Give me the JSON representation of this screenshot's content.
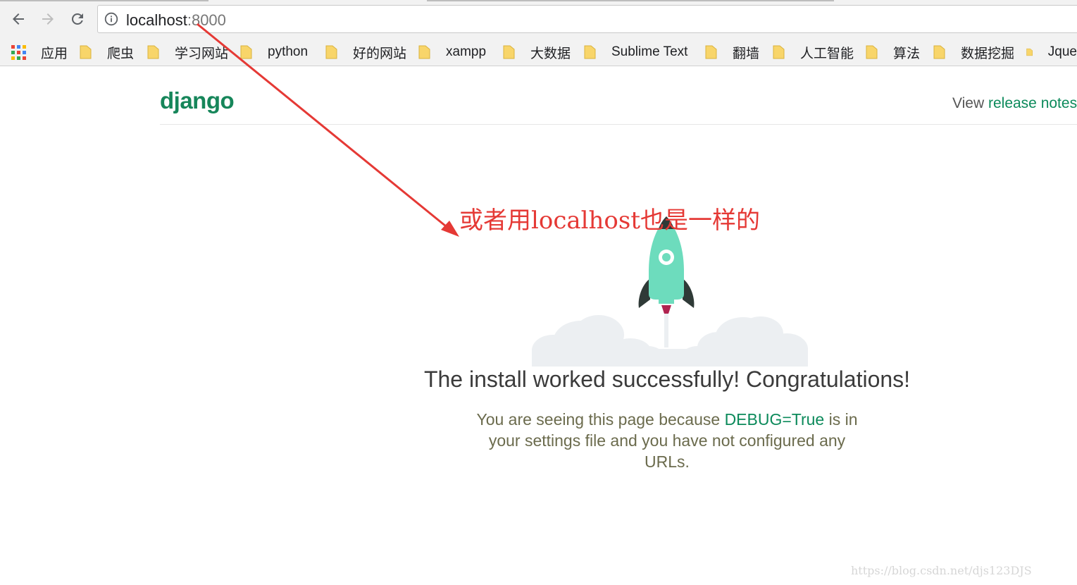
{
  "browser": {
    "url_host": "localhost",
    "url_port": ":8000",
    "bookmarks": [
      "应用",
      "爬虫",
      "学习网站",
      "python",
      "好的网站",
      "xampp",
      "大数据",
      "Sublime Text",
      "翻墙",
      "人工智能",
      "算法",
      "数据挖掘",
      "Jque"
    ]
  },
  "page": {
    "logo": "django",
    "release_prefix": "View ",
    "release_link": "release notes",
    "headline": "The install worked successfully! Congratulations!",
    "sub_part1": "You are seeing this page because ",
    "sub_debug": "DEBUG=True",
    "sub_part2": " is in your settings file and you have not configured any URLs."
  },
  "annotation": {
    "text": "或者用localhost也是一样的"
  },
  "watermark": "https://blog.csdn.net/djs123DJS",
  "colors": {
    "django_green": "#0c8a5b",
    "annotation_red": "#e53935",
    "rocket_teal": "#6ddcbd"
  }
}
